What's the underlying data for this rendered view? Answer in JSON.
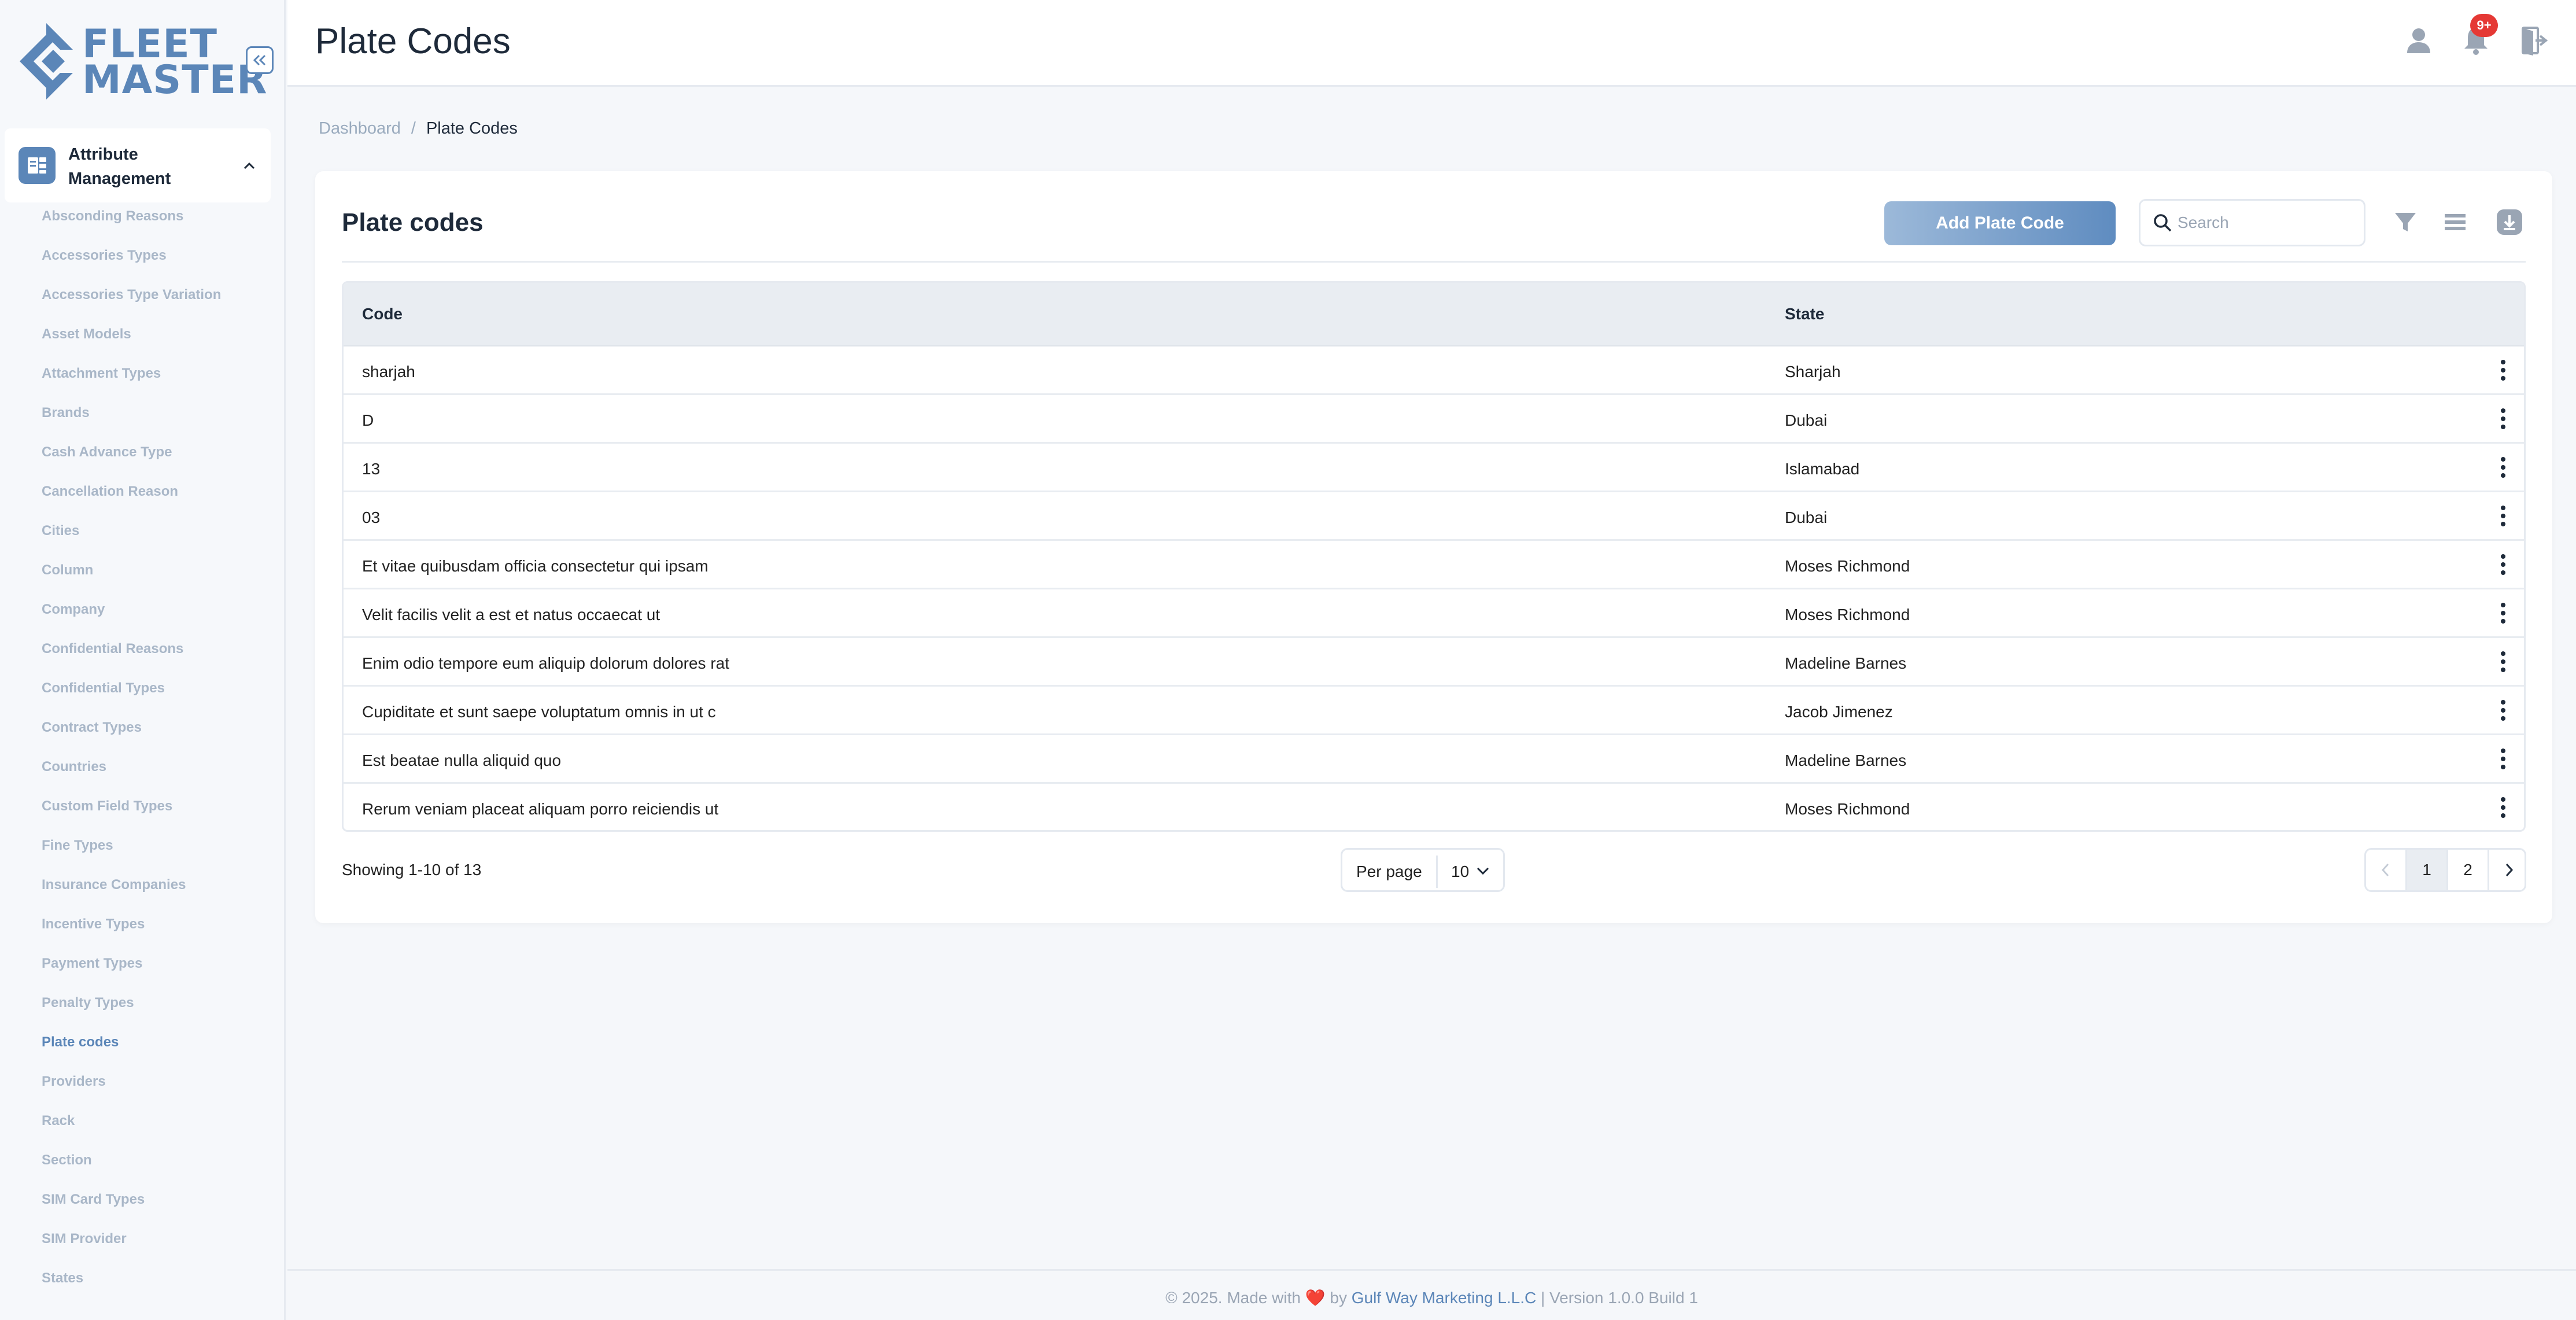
{
  "app": {
    "logo_line1": "FLEET",
    "logo_line2": "MASTER",
    "brand_color": "#5b86b8"
  },
  "sidebar": {
    "section_title": "Attribute Management",
    "items": [
      {
        "label": "Absconding Reasons",
        "active": false
      },
      {
        "label": "Accessories Types",
        "active": false
      },
      {
        "label": "Accessories Type Variation",
        "active": false
      },
      {
        "label": "Asset Models",
        "active": false
      },
      {
        "label": "Attachment Types",
        "active": false
      },
      {
        "label": "Brands",
        "active": false
      },
      {
        "label": "Cash Advance Type",
        "active": false
      },
      {
        "label": "Cancellation Reason",
        "active": false
      },
      {
        "label": "Cities",
        "active": false
      },
      {
        "label": "Column",
        "active": false
      },
      {
        "label": "Company",
        "active": false
      },
      {
        "label": "Confidential Reasons",
        "active": false
      },
      {
        "label": "Confidential Types",
        "active": false
      },
      {
        "label": "Contract Types",
        "active": false
      },
      {
        "label": "Countries",
        "active": false
      },
      {
        "label": "Custom Field Types",
        "active": false
      },
      {
        "label": "Fine Types",
        "active": false
      },
      {
        "label": "Insurance Companies",
        "active": false
      },
      {
        "label": "Incentive Types",
        "active": false
      },
      {
        "label": "Payment Types",
        "active": false
      },
      {
        "label": "Penalty Types",
        "active": false
      },
      {
        "label": "Plate codes",
        "active": true
      },
      {
        "label": "Providers",
        "active": false
      },
      {
        "label": "Rack",
        "active": false
      },
      {
        "label": "Section",
        "active": false
      },
      {
        "label": "SIM Card Types",
        "active": false
      },
      {
        "label": "SIM Provider",
        "active": false
      },
      {
        "label": "States",
        "active": false
      }
    ]
  },
  "header": {
    "title": "Plate Codes",
    "notification_badge": "9+"
  },
  "breadcrumb": {
    "home": "Dashboard",
    "separator": "/",
    "current": "Plate Codes"
  },
  "card": {
    "title": "Plate codes",
    "add_button": "Add Plate Code",
    "search_placeholder": "Search"
  },
  "table": {
    "columns": [
      "Code",
      "State"
    ],
    "rows": [
      {
        "code": "sharjah",
        "state": "Sharjah"
      },
      {
        "code": "D",
        "state": "Dubai"
      },
      {
        "code": "13",
        "state": "Islamabad"
      },
      {
        "code": "03",
        "state": "Dubai"
      },
      {
        "code": "Et vitae quibusdam officia consectetur qui ipsam",
        "state": "Moses Richmond"
      },
      {
        "code": "Velit facilis velit a est et natus occaecat ut",
        "state": "Moses Richmond"
      },
      {
        "code": "Enim odio tempore eum aliquip dolorum dolores rat",
        "state": "Madeline Barnes"
      },
      {
        "code": "Cupiditate et sunt saepe voluptatum omnis in ut c",
        "state": "Jacob Jimenez"
      },
      {
        "code": "Est beatae nulla aliquid quo",
        "state": "Madeline Barnes"
      },
      {
        "code": "Rerum veniam placeat aliquam porro reiciendis ut",
        "state": "Moses Richmond"
      }
    ]
  },
  "pagination": {
    "showing": "Showing 1-10 of 13",
    "per_page_label": "Per page",
    "per_page_value": "10",
    "pages": [
      "1",
      "2"
    ],
    "current_page": "1"
  },
  "footer": {
    "prefix": "© 2025. Made with",
    "heart": "❤️",
    "by": "by",
    "company": "Gulf Way Marketing L.L.C",
    "suffix": "| Version 1.0.0 Build 1"
  }
}
